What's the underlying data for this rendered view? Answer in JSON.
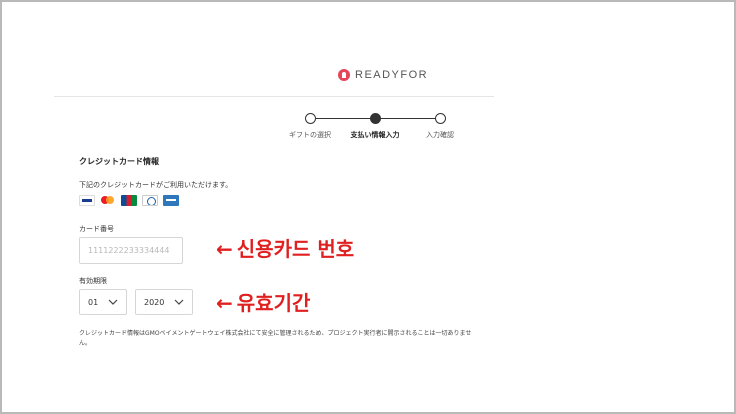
{
  "header": {
    "logo_text": "READYFOR"
  },
  "steps": [
    {
      "label": "ギフトの選択",
      "state": "done"
    },
    {
      "label": "支払い情報入力",
      "state": "current"
    },
    {
      "label": "入力確認",
      "state": "todo"
    }
  ],
  "form": {
    "section_title": "クレジットカード情報",
    "available_text": "下記のクレジットカードがご利用いただけます。",
    "card_brands": [
      "visa-icon",
      "mastercard-icon",
      "jcb-icon",
      "diners-icon",
      "amex-icon"
    ],
    "card_number": {
      "label": "カード番号",
      "value": "",
      "placeholder": "1111222233334444"
    },
    "expiry": {
      "label": "有効期限",
      "month": "01",
      "year": "2020"
    },
    "notice": "クレジットカード情報はGMOペイメントゲートウェイ株式会社にて安全に管理されるため、プロジェクト実行者に開示されることは一切ありません。"
  },
  "annotations": {
    "card_number": "신용카드 번호",
    "expiry": "유효기간",
    "arrow": "←",
    "color": "#e02020"
  },
  "colors": {
    "brand": "#e5455a",
    "step_active": "#333333"
  }
}
